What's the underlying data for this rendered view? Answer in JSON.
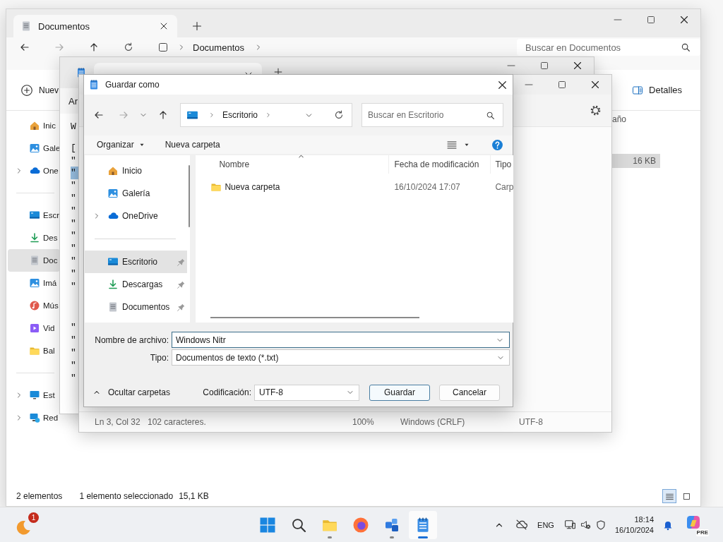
{
  "explorer": {
    "tab": "Documentos",
    "breadcrumb": "Documentos",
    "search_placeholder": "Buscar en Documentos",
    "new_label": "Nuev",
    "details_label": "Detalles",
    "sidebar": [
      [
        {
          "kind": "home",
          "label": "Inic",
          "expandable": false,
          "selected": false
        },
        {
          "kind": "gallery",
          "label": "Gale",
          "expandable": false,
          "selected": false
        },
        {
          "kind": "cloud",
          "label": "One",
          "expandable": true,
          "selected": false
        }
      ],
      [
        {
          "kind": "desktop",
          "label": "Escr",
          "expandable": false,
          "selected": false
        },
        {
          "kind": "download",
          "label": "Des",
          "expandable": false,
          "selected": false
        },
        {
          "kind": "documents",
          "label": "Doc",
          "expandable": false,
          "selected": true
        },
        {
          "kind": "gallery",
          "label": "Imá",
          "expandable": false,
          "selected": false
        },
        {
          "kind": "music",
          "label": "Mús",
          "expandable": false,
          "selected": false
        },
        {
          "kind": "video",
          "label": "Vid",
          "expandable": false,
          "selected": false
        },
        {
          "kind": "folder",
          "label": "Bal",
          "expandable": false,
          "selected": false
        }
      ],
      [
        {
          "kind": "pc",
          "label": "Est",
          "expandable": true,
          "selected": false
        },
        {
          "kind": "network",
          "label": "Red",
          "expandable": true,
          "selected": false
        }
      ]
    ],
    "column": "año",
    "rows": [
      {
        "size": "16 KB",
        "selected": true
      }
    ],
    "status": {
      "count": "2 elementos",
      "selection": "1 elemento seleccionado",
      "size": "15,1 KB"
    },
    "views": [
      {
        "kind": "details",
        "selected": true
      },
      {
        "kind": "tiles",
        "selected": false
      }
    ]
  },
  "back_editor": {
    "menu": "Ar",
    "blocks": [
      [
        {
          "text": "W",
          "selected": false
        }
      ],
      [
        {
          "text": "[",
          "selected": false
        },
        {
          "text": "\"",
          "selected": false
        },
        {
          "text": "\"",
          "selected": true
        },
        {
          "text": "\"",
          "selected": false
        },
        {
          "text": "\"",
          "selected": false
        },
        {
          "text": "\"",
          "selected": false
        },
        {
          "text": "\"",
          "selected": false
        },
        {
          "text": "\"",
          "selected": false
        },
        {
          "text": "\"",
          "selected": false
        },
        {
          "text": "\"",
          "selected": false
        },
        {
          "text": "\"",
          "selected": false
        },
        {
          "text": "\"",
          "selected": false
        }
      ],
      [
        {
          "text": "\"",
          "selected": false
        },
        {
          "text": "\"",
          "selected": false
        },
        {
          "text": "\"",
          "selected": false
        },
        {
          "text": "\"",
          "selected": false
        },
        {
          "text": "\"",
          "selected": false
        }
      ]
    ]
  },
  "editor": {
    "status": [
      "Ln 3, Col 32",
      "102 caracteres.",
      "100%",
      "Windows (CRLF)",
      "UTF-8"
    ]
  },
  "dialog": {
    "title": "Guardar como",
    "address": "Escritorio",
    "search_placeholder": "Buscar en Escritorio",
    "organize": "Organizar",
    "new_folder": "Nueva carpeta",
    "nav": [
      [
        {
          "kind": "home",
          "label": "Inicio",
          "expandable": false,
          "pinned": false,
          "selected": false
        },
        {
          "kind": "gallery",
          "label": "Galería",
          "expandable": false,
          "pinned": false,
          "selected": false
        },
        {
          "kind": "cloud",
          "label": "OneDrive",
          "expandable": true,
          "pinned": false,
          "selected": false
        }
      ],
      [
        {
          "kind": "desktop",
          "label": "Escritorio",
          "expandable": false,
          "pinned": true,
          "selected": true
        },
        {
          "kind": "download",
          "label": "Descargas",
          "expandable": false,
          "pinned": true,
          "selected": false
        },
        {
          "kind": "documents",
          "label": "Documentos",
          "expandable": false,
          "pinned": true,
          "selected": false
        }
      ]
    ],
    "columns": [
      {
        "label": "Nombre",
        "sorted": true
      },
      {
        "label": "Fecha de modificación",
        "sorted": false
      },
      {
        "label": "Tipo",
        "sorted": false
      }
    ],
    "files": [
      {
        "kind": "folder",
        "name": "Nueva carpeta",
        "modified": "16/10/2024 17:07",
        "type": "Carp"
      }
    ],
    "filename_label": "Nombre de archivo:",
    "filename": "Windows Nitr",
    "type_label": "Tipo:",
    "type_value": "Documentos de texto (*.txt)",
    "hide_folders": "Ocultar carpetas",
    "encoding_label": "Codificación:",
    "encoding": "UTF-8",
    "buttons": [
      {
        "label": "Guardar",
        "default": true
      },
      {
        "label": "Cancelar",
        "default": false
      }
    ]
  },
  "taskbar": {
    "widget_badge": "1",
    "apps": [
      {
        "kind": "start",
        "running": false,
        "active": false
      },
      {
        "kind": "search",
        "running": false,
        "active": false
      },
      {
        "kind": "folder",
        "running": true,
        "active": false
      },
      {
        "kind": "browser",
        "running": false,
        "active": false
      },
      {
        "kind": "cubes",
        "running": true,
        "active": false
      },
      {
        "kind": "notepad",
        "running": true,
        "active": true
      }
    ],
    "language": "ENG",
    "time": "18:14",
    "date": "16/10/2024",
    "app_badge": "PRE"
  }
}
